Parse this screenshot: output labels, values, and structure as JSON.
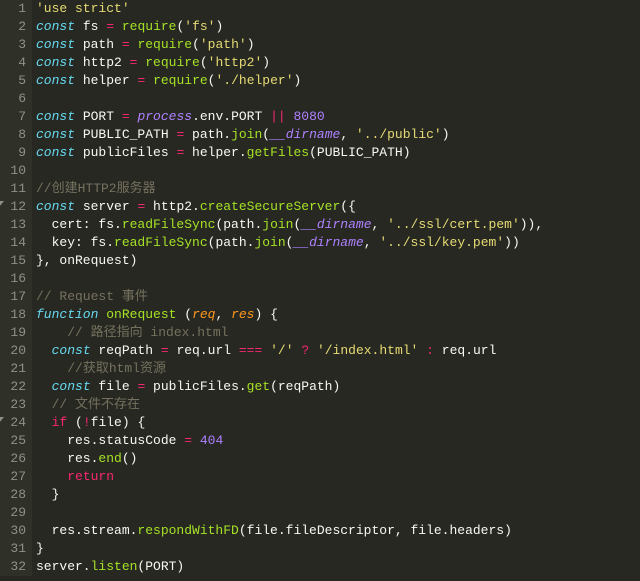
{
  "lines": [
    {
      "n": 1,
      "fold": null,
      "seg": [
        [
          "str",
          "'use strict'"
        ]
      ]
    },
    {
      "n": 2,
      "fold": null,
      "seg": [
        [
          "kw",
          "const"
        ],
        [
          "pl",
          " fs "
        ],
        [
          "op",
          "="
        ],
        [
          "pl",
          " "
        ],
        [
          "fn",
          "require"
        ],
        [
          "pl",
          "("
        ],
        [
          "str",
          "'fs'"
        ],
        [
          "pl",
          ")"
        ]
      ]
    },
    {
      "n": 3,
      "fold": null,
      "seg": [
        [
          "kw",
          "const"
        ],
        [
          "pl",
          " path "
        ],
        [
          "op",
          "="
        ],
        [
          "pl",
          " "
        ],
        [
          "fn",
          "require"
        ],
        [
          "pl",
          "("
        ],
        [
          "str",
          "'path'"
        ],
        [
          "pl",
          ")"
        ]
      ]
    },
    {
      "n": 4,
      "fold": null,
      "seg": [
        [
          "kw",
          "const"
        ],
        [
          "pl",
          " http2 "
        ],
        [
          "op",
          "="
        ],
        [
          "pl",
          " "
        ],
        [
          "fn",
          "require"
        ],
        [
          "pl",
          "("
        ],
        [
          "str",
          "'http2'"
        ],
        [
          "pl",
          ")"
        ]
      ]
    },
    {
      "n": 5,
      "fold": null,
      "seg": [
        [
          "kw",
          "const"
        ],
        [
          "pl",
          " helper "
        ],
        [
          "op",
          "="
        ],
        [
          "pl",
          " "
        ],
        [
          "fn",
          "require"
        ],
        [
          "pl",
          "("
        ],
        [
          "str",
          "'./helper'"
        ],
        [
          "pl",
          ")"
        ]
      ]
    },
    {
      "n": 6,
      "fold": null,
      "seg": [
        [
          "pl",
          ""
        ]
      ]
    },
    {
      "n": 7,
      "fold": null,
      "seg": [
        [
          "kw",
          "const"
        ],
        [
          "pl",
          " PORT "
        ],
        [
          "op",
          "="
        ],
        [
          "pl",
          " "
        ],
        [
          "con",
          "process"
        ],
        [
          "pl",
          ".env.PORT "
        ],
        [
          "op",
          "||"
        ],
        [
          "pl",
          " "
        ],
        [
          "num",
          "8080"
        ]
      ]
    },
    {
      "n": 8,
      "fold": null,
      "seg": [
        [
          "kw",
          "const"
        ],
        [
          "pl",
          " PUBLIC_PATH "
        ],
        [
          "op",
          "="
        ],
        [
          "pl",
          " path."
        ],
        [
          "fn",
          "join"
        ],
        [
          "pl",
          "("
        ],
        [
          "con",
          "__dirname"
        ],
        [
          "pl",
          ", "
        ],
        [
          "str",
          "'../public'"
        ],
        [
          "pl",
          ")"
        ]
      ]
    },
    {
      "n": 9,
      "fold": null,
      "seg": [
        [
          "kw",
          "const"
        ],
        [
          "pl",
          " publicFiles "
        ],
        [
          "op",
          "="
        ],
        [
          "pl",
          " helper."
        ],
        [
          "fn",
          "getFiles"
        ],
        [
          "pl",
          "(PUBLIC_PATH)"
        ]
      ]
    },
    {
      "n": 10,
      "fold": null,
      "seg": [
        [
          "pl",
          ""
        ]
      ]
    },
    {
      "n": 11,
      "fold": null,
      "seg": [
        [
          "cm",
          "//创建HTTP2服务器"
        ]
      ]
    },
    {
      "n": 12,
      "fold": "open",
      "seg": [
        [
          "kw",
          "const"
        ],
        [
          "pl",
          " server "
        ],
        [
          "op",
          "="
        ],
        [
          "pl",
          " http2."
        ],
        [
          "fn",
          "createSecureServer"
        ],
        [
          "pl",
          "({"
        ]
      ]
    },
    {
      "n": 13,
      "fold": null,
      "seg": [
        [
          "pl",
          "  cert: fs."
        ],
        [
          "fn",
          "readFileSync"
        ],
        [
          "pl",
          "(path."
        ],
        [
          "fn",
          "join"
        ],
        [
          "pl",
          "("
        ],
        [
          "con",
          "__dirname"
        ],
        [
          "pl",
          ", "
        ],
        [
          "str",
          "'../ssl/cert.pem'"
        ],
        [
          "pl",
          ")),"
        ]
      ]
    },
    {
      "n": 14,
      "fold": null,
      "seg": [
        [
          "pl",
          "  key: fs."
        ],
        [
          "fn",
          "readFileSync"
        ],
        [
          "pl",
          "(path."
        ],
        [
          "fn",
          "join"
        ],
        [
          "pl",
          "("
        ],
        [
          "con",
          "__dirname"
        ],
        [
          "pl",
          ", "
        ],
        [
          "str",
          "'../ssl/key.pem'"
        ],
        [
          "pl",
          "))"
        ]
      ]
    },
    {
      "n": 15,
      "fold": null,
      "seg": [
        [
          "pl",
          "}, onRequest)"
        ]
      ]
    },
    {
      "n": 16,
      "fold": null,
      "seg": [
        [
          "pl",
          ""
        ]
      ]
    },
    {
      "n": 17,
      "fold": null,
      "seg": [
        [
          "cm",
          "// Request 事件"
        ]
      ]
    },
    {
      "n": 18,
      "fold": null,
      "seg": [
        [
          "kw",
          "function"
        ],
        [
          "pl",
          " "
        ],
        [
          "fnd",
          "onRequest"
        ],
        [
          "pl",
          " ("
        ],
        [
          "arg",
          "req"
        ],
        [
          "pl",
          ", "
        ],
        [
          "arg",
          "res"
        ],
        [
          "pl",
          ") {"
        ]
      ]
    },
    {
      "n": 19,
      "fold": null,
      "seg": [
        [
          "pl",
          "    "
        ],
        [
          "cm",
          "// 路径指向 index.html"
        ]
      ]
    },
    {
      "n": 20,
      "fold": null,
      "seg": [
        [
          "pl",
          "  "
        ],
        [
          "kw",
          "const"
        ],
        [
          "pl",
          " reqPath "
        ],
        [
          "op",
          "="
        ],
        [
          "pl",
          " req.url "
        ],
        [
          "op",
          "==="
        ],
        [
          "pl",
          " "
        ],
        [
          "str",
          "'/'"
        ],
        [
          "pl",
          " "
        ],
        [
          "op",
          "?"
        ],
        [
          "pl",
          " "
        ],
        [
          "str",
          "'/index.html'"
        ],
        [
          "pl",
          " "
        ],
        [
          "op",
          ":"
        ],
        [
          "pl",
          " req.url"
        ]
      ]
    },
    {
      "n": 21,
      "fold": null,
      "seg": [
        [
          "pl",
          "    "
        ],
        [
          "cm",
          "//获取html资源"
        ]
      ]
    },
    {
      "n": 22,
      "fold": null,
      "seg": [
        [
          "pl",
          "  "
        ],
        [
          "kw",
          "const"
        ],
        [
          "pl",
          " file "
        ],
        [
          "op",
          "="
        ],
        [
          "pl",
          " publicFiles."
        ],
        [
          "fn",
          "get"
        ],
        [
          "pl",
          "(reqPath)"
        ]
      ]
    },
    {
      "n": 23,
      "fold": null,
      "seg": [
        [
          "pl",
          "  "
        ],
        [
          "cm",
          "// 文件不存在"
        ]
      ]
    },
    {
      "n": 24,
      "fold": "open",
      "seg": [
        [
          "pl",
          "  "
        ],
        [
          "kw2",
          "if"
        ],
        [
          "pl",
          " ("
        ],
        [
          "op",
          "!"
        ],
        [
          "pl",
          "file) {"
        ]
      ]
    },
    {
      "n": 25,
      "fold": null,
      "seg": [
        [
          "pl",
          "    res.statusCode "
        ],
        [
          "op",
          "="
        ],
        [
          "pl",
          " "
        ],
        [
          "num",
          "404"
        ]
      ]
    },
    {
      "n": 26,
      "fold": null,
      "seg": [
        [
          "pl",
          "    res."
        ],
        [
          "fn",
          "end"
        ],
        [
          "pl",
          "()"
        ]
      ]
    },
    {
      "n": 27,
      "fold": null,
      "seg": [
        [
          "pl",
          "    "
        ],
        [
          "kw2",
          "return"
        ]
      ]
    },
    {
      "n": 28,
      "fold": null,
      "seg": [
        [
          "pl",
          "  }"
        ]
      ]
    },
    {
      "n": 29,
      "fold": null,
      "seg": [
        [
          "pl",
          ""
        ]
      ]
    },
    {
      "n": 30,
      "fold": null,
      "seg": [
        [
          "pl",
          "  res.stream."
        ],
        [
          "fn",
          "respondWithFD"
        ],
        [
          "pl",
          "(file.fileDescriptor, file.headers)"
        ]
      ]
    },
    {
      "n": 31,
      "fold": null,
      "seg": [
        [
          "pl",
          "}"
        ]
      ]
    },
    {
      "n": 32,
      "fold": null,
      "seg": [
        [
          "pl",
          "server."
        ],
        [
          "fn",
          "listen"
        ],
        [
          "pl",
          "(PORT)"
        ]
      ]
    }
  ]
}
